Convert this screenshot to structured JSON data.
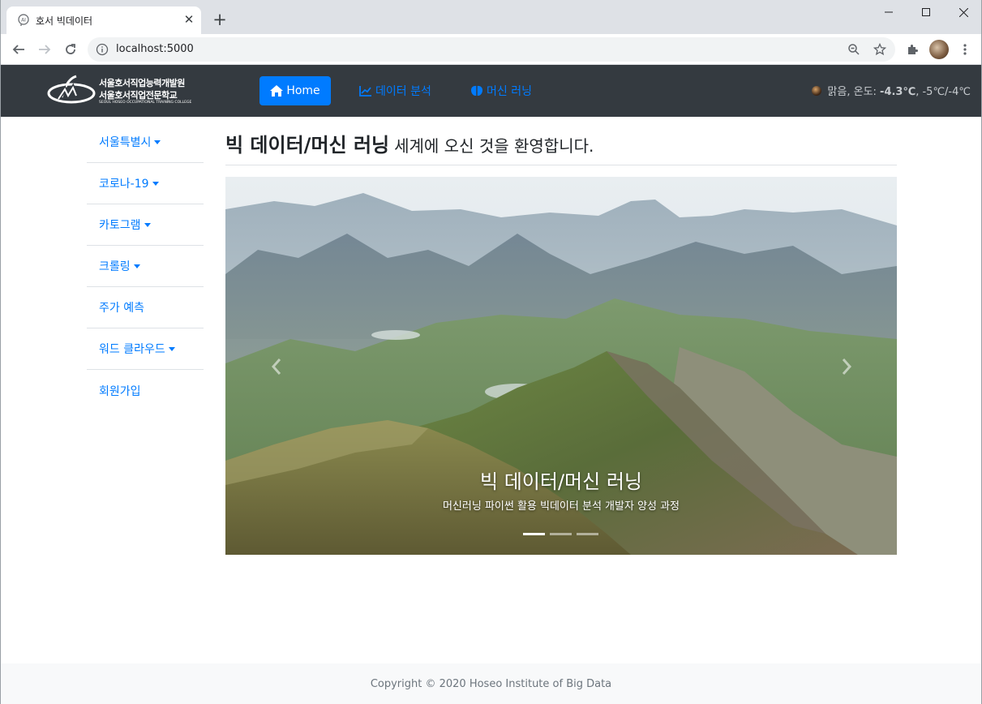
{
  "browser": {
    "tab_title": "호서 빅데이터",
    "url": "localhost:5000"
  },
  "navbar": {
    "logo": {
      "line1": "서울호서직업능력개발원",
      "line2": "서울호서직업전문학교",
      "line3": "SEOUL HOSEO OCCUPATIONAL TRAINING COLLEGE"
    },
    "home_label": "Home",
    "links": [
      "데이터 분석",
      "머신 러닝"
    ],
    "weather": {
      "condition": "맑음, 온도: ",
      "temp": "-4.3℃",
      "range": ", -5℃/-4℃"
    }
  },
  "sidebar": {
    "items": [
      {
        "label": "서울특별시",
        "dropdown": true
      },
      {
        "label": "코로나-19",
        "dropdown": true
      },
      {
        "label": "카토그램",
        "dropdown": true
      },
      {
        "label": "크롤링",
        "dropdown": true
      },
      {
        "label": "주가 예측",
        "dropdown": false
      },
      {
        "label": "워드 클라우드",
        "dropdown": true
      },
      {
        "label": "회원가입",
        "dropdown": false
      }
    ]
  },
  "main": {
    "heading_strong": "빅 데이터/머신 러닝",
    "heading_sub": "세계에 오신 것을 환영합니다.",
    "carousel": {
      "caption_title": "빅 데이터/머신 러닝",
      "caption_text": "머신러닝 파이썬 활용 빅데이터 분석 개발자 양성 과정",
      "slide_count": 3,
      "active_slide": 1
    }
  },
  "footer": {
    "text": "Copyright © 2020 Hoseo Institute of Big Data"
  },
  "colors": {
    "primary": "#007bff",
    "navbar_bg": "#343a40",
    "footer_bg": "#f8f9fa"
  }
}
